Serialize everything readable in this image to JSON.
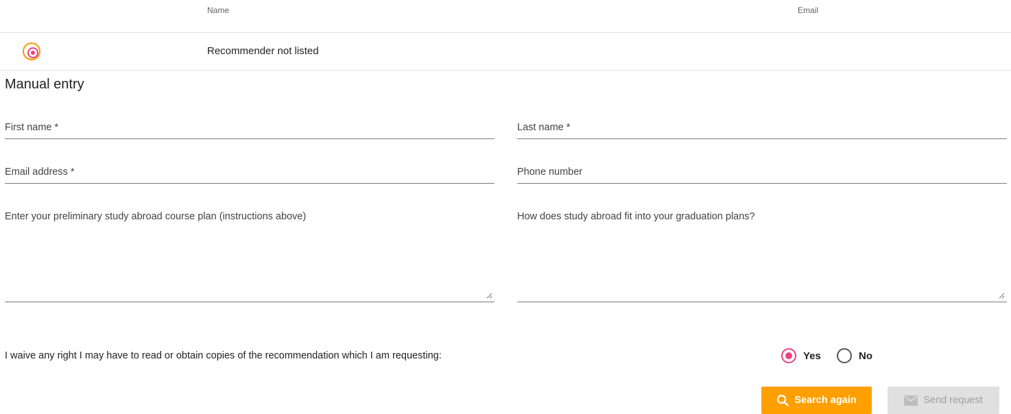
{
  "table": {
    "headers": {
      "name": "Name",
      "email": "Email"
    },
    "row": {
      "name": "Recommender not listed",
      "selected": true
    }
  },
  "manual": {
    "title": "Manual entry",
    "first_name_label": "First name *",
    "last_name_label": "Last name *",
    "email_label": "Email address *",
    "phone_label": "Phone number",
    "course_plan_label": "Enter your preliminary study abroad course plan (instructions above)",
    "graduation_label": "How does study abroad fit into your graduation plans?"
  },
  "waiver": {
    "text": "I waive any right I may have to read or obtain copies of the recommendation which I am requesting:",
    "options": [
      {
        "label": "Yes",
        "selected": true
      },
      {
        "label": "No",
        "selected": false
      }
    ]
  },
  "buttons": {
    "search_again": "Search again",
    "send_request": "Send request"
  },
  "colors": {
    "accent_pink": "#ec407a",
    "accent_orange": "#ffa000",
    "disabled_bg": "#e0e0e0",
    "disabled_text": "#9e9e9e"
  },
  "icons": {
    "search_button": "search-icon",
    "send_button": "mail-icon"
  }
}
